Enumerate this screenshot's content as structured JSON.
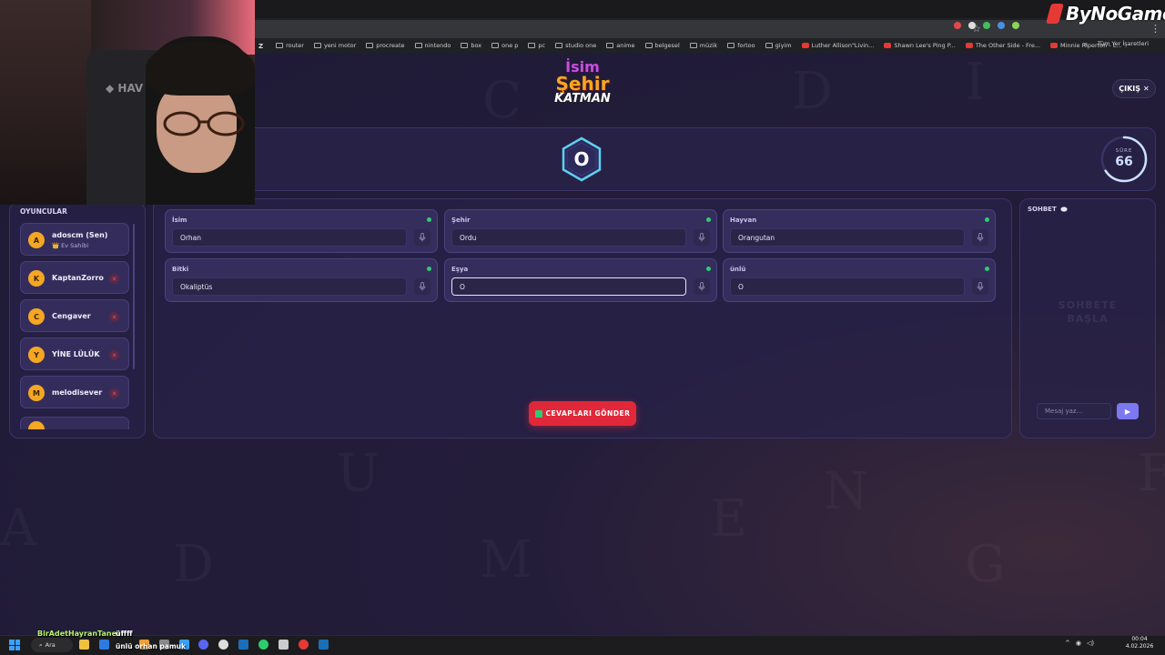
{
  "browser": {
    "bookmarks": [
      {
        "label": "router",
        "icon": "folder-icon"
      },
      {
        "label": "yeni motor",
        "icon": "folder-icon"
      },
      {
        "label": "procreate",
        "icon": "folder-icon"
      },
      {
        "label": "nintendo",
        "icon": "folder-icon"
      },
      {
        "label": "box",
        "icon": "folder-icon"
      },
      {
        "label": "one p",
        "icon": "folder-icon"
      },
      {
        "label": "pc",
        "icon": "folder-icon"
      },
      {
        "label": "studio one",
        "icon": "folder-icon"
      },
      {
        "label": "anime",
        "icon": "folder-icon"
      },
      {
        "label": "belgesel",
        "icon": "folder-icon"
      },
      {
        "label": "müzik",
        "icon": "folder-icon"
      },
      {
        "label": "fortoo",
        "icon": "folder-icon"
      },
      {
        "label": "giyim",
        "icon": "folder-icon"
      },
      {
        "label": "Luther Allison\"Livin...",
        "icon": "youtube-icon"
      },
      {
        "label": "Shawn Lee's Ping P...",
        "icon": "youtube-icon"
      },
      {
        "label": "The Other Side - Fre...",
        "icon": "youtube-icon"
      },
      {
        "label": "Minnie Riperton - L...",
        "icon": "youtube-icon"
      }
    ],
    "bookmark_prefix": "Z",
    "bookmarks_more": "»",
    "all_bookmarks": "Tüm Yer İşaretleri"
  },
  "brand": {
    "name": "ByNoGame"
  },
  "logo": {
    "line1": "İsim",
    "line2": "Şehir",
    "line3": "KATMAN"
  },
  "header": {
    "exit_label": "ÇIKIŞ",
    "exit_icon": "✕"
  },
  "round": {
    "letter": "O",
    "timer_label": "SÜRE",
    "timer_value": "66",
    "timer_fraction": 0.66
  },
  "players": {
    "heading": "OYUNCULAR",
    "items": [
      {
        "initial": "A",
        "name": "adoscm (Sen)",
        "subtitle": "👑 Ev Sahibi"
      },
      {
        "initial": "K",
        "name": "KaptanZorro",
        "kick": "✕"
      },
      {
        "initial": "C",
        "name": "Cengaver",
        "kick": "✕"
      },
      {
        "initial": "Y",
        "name": "YİNE LÜLÜK",
        "kick": "✕"
      },
      {
        "initial": "M",
        "name": "melodisever",
        "kick": "✕"
      }
    ]
  },
  "form": {
    "fields": [
      {
        "label": "İsim",
        "value": "Orhan"
      },
      {
        "label": "Şehir",
        "value": "Ordu"
      },
      {
        "label": "Hayvan",
        "value": "Orangutan"
      },
      {
        "label": "Bitki",
        "value": "Okaliptüs"
      },
      {
        "label": "Eşya",
        "value": "O"
      },
      {
        "label": "ünlü",
        "value": "O"
      }
    ],
    "submit_label": "CEVAPLARI GÖNDER"
  },
  "chat": {
    "heading": "SOHBET",
    "empty_line1": "SOHBETE",
    "empty_line2": "BAŞLA",
    "input_placeholder": "Mesaj yaz...",
    "send_icon": "▶"
  },
  "taskbar": {
    "search_label": "Ara",
    "clock_time": "00:04",
    "clock_date": "4.02.2026"
  },
  "stream_overlay": {
    "chat_user": "BirAdetHayranTanesi",
    "chat_message": "üffff",
    "caption": "ünlü orhan pamuk"
  },
  "colors": {
    "accent": "#e0283a",
    "background": "#1e1a36",
    "online": "#2ecc71",
    "avatar": "#f5a623",
    "send": "#7b78f0"
  }
}
